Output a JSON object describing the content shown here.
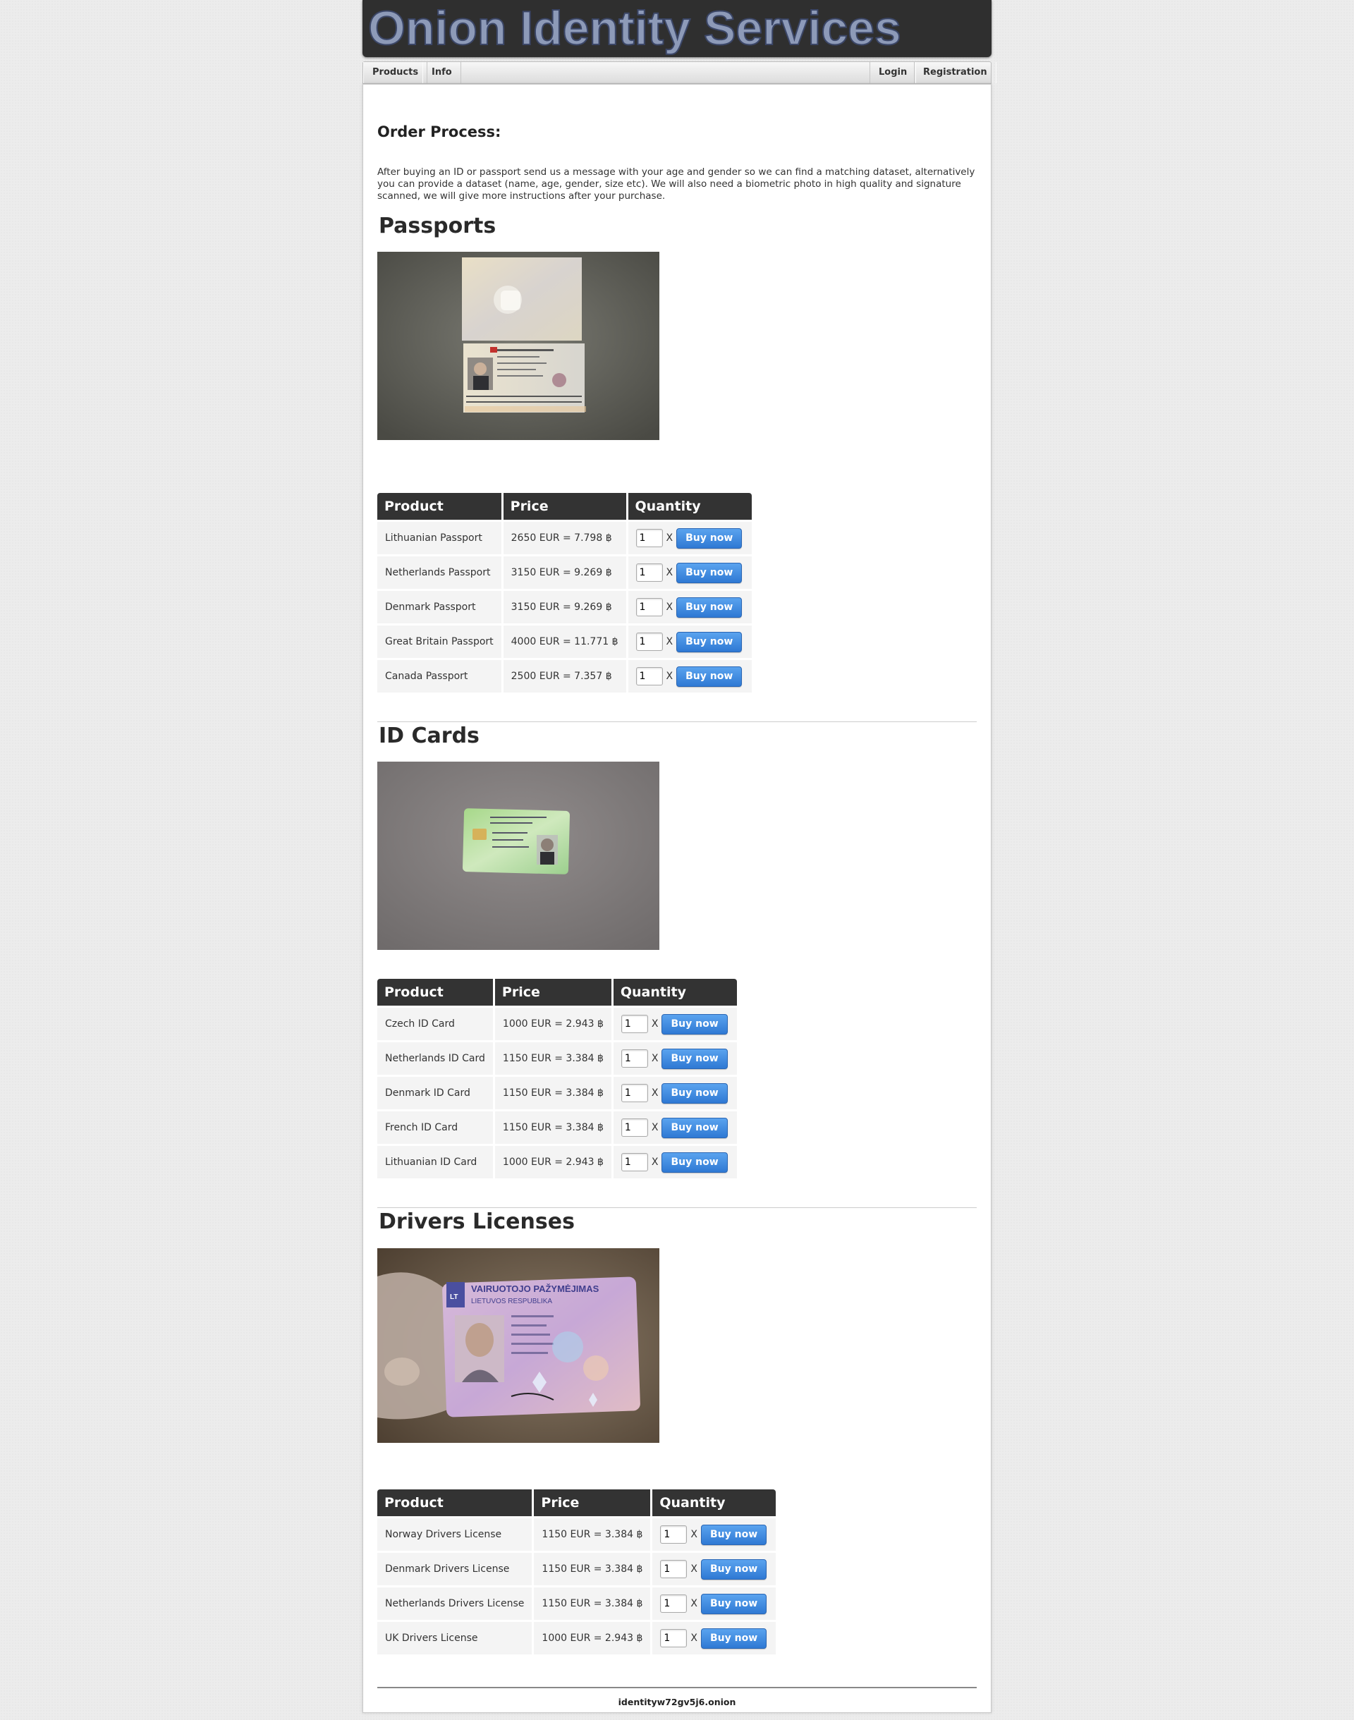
{
  "header": {
    "title": "Onion Identity Services"
  },
  "nav": {
    "left": [
      {
        "label": "Products"
      },
      {
        "label": "Info"
      }
    ],
    "right": [
      {
        "label": "Login"
      },
      {
        "label": "Registration"
      }
    ]
  },
  "order": {
    "title": "Order Process:",
    "text": "After buying an ID or passport send us a message with your age and gender so we can find a matching dataset, alternatively you can provide a dataset (name, age, gender, size etc). We will also need a biometric photo in high quality and signature scanned, we will give more instructions after your purchase."
  },
  "table_headers": {
    "product": "Product",
    "price": "Price",
    "quantity": "Quantity"
  },
  "buy_label": "Buy now",
  "qty_separator": "X",
  "sections": [
    {
      "title": "Passports",
      "products": [
        {
          "name": "Lithuanian Passport",
          "price": "2650 EUR = 7.798 ฿",
          "qty": "1"
        },
        {
          "name": "Netherlands Passport",
          "price": "3150 EUR = 9.269 ฿",
          "qty": "1"
        },
        {
          "name": "Denmark Passport",
          "price": "3150 EUR = 9.269 ฿",
          "qty": "1"
        },
        {
          "name": "Great Britain Passport",
          "price": "4000 EUR = 11.771 ฿",
          "qty": "1"
        },
        {
          "name": "Canada Passport",
          "price": "2500 EUR = 7.357 ฿",
          "qty": "1"
        }
      ]
    },
    {
      "title": "ID Cards",
      "products": [
        {
          "name": "Czech ID Card",
          "price": "1000 EUR = 2.943 ฿",
          "qty": "1"
        },
        {
          "name": "Netherlands ID Card",
          "price": "1150 EUR = 3.384 ฿",
          "qty": "1"
        },
        {
          "name": "Denmark ID Card",
          "price": "1150 EUR = 3.384 ฿",
          "qty": "1"
        },
        {
          "name": "French ID Card",
          "price": "1150 EUR = 3.384 ฿",
          "qty": "1"
        },
        {
          "name": "Lithuanian ID Card",
          "price": "1000 EUR = 2.943 ฿",
          "qty": "1"
        }
      ]
    },
    {
      "title": "Drivers Licenses",
      "products": [
        {
          "name": "Norway Drivers License",
          "price": "1150 EUR = 3.384 ฿",
          "qty": "1"
        },
        {
          "name": "Denmark Drivers License",
          "price": "1150 EUR = 3.384 ฿",
          "qty": "1"
        },
        {
          "name": "Netherlands Drivers License",
          "price": "1150 EUR = 3.384 ฿",
          "qty": "1"
        },
        {
          "name": "UK Drivers License",
          "price": "1000 EUR = 2.943 ฿",
          "qty": "1"
        }
      ]
    }
  ],
  "license_photo_text": {
    "heading": "VAIRUOTOJO PAŽYMĖJIMAS",
    "subheading": "LIETUVOS RESPUBLIKA",
    "country": "LT"
  },
  "footer": {
    "domain": "identityw72gv5j6.onion"
  }
}
